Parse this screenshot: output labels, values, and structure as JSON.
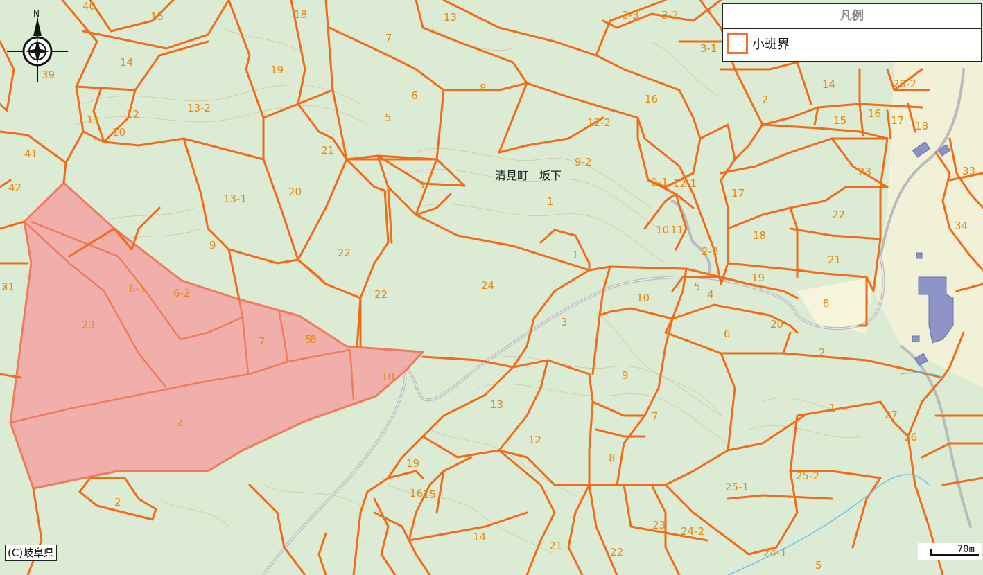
{
  "map": {
    "place_name": "清見町　坂下",
    "compass_north": "N",
    "copyright": "(C)岐阜県",
    "scale_label": "70m",
    "colors": {
      "background": "#dcebd3",
      "boundary": "#f06c18",
      "label": "#e8870e",
      "highlight_fill": "#f4a4a4",
      "highlight_stroke": "#f07a5a",
      "road": "#b9bbbd",
      "building": "#8d93c7"
    }
  },
  "legend": {
    "title": "凡例",
    "items": [
      {
        "label": "小班界",
        "swatch": "orange-outline"
      }
    ]
  },
  "parcels": {
    "highlighted": [
      "5",
      "6-1",
      "6-2",
      "7",
      "8",
      "3",
      "4"
    ],
    "labels": [
      "15",
      "18",
      "13",
      "3-3",
      "3-2",
      "3-1",
      "40",
      "14",
      "39",
      "7",
      "19",
      "13-2",
      "12",
      "11",
      "10",
      "41",
      "6",
      "8",
      "5",
      "16",
      "12-2",
      "14",
      "20-2",
      "16",
      "15",
      "17",
      "18",
      "21",
      "3",
      "4",
      "42",
      "20",
      "13-1",
      "9-2",
      "9-1",
      "12-1",
      "17",
      "23",
      "33",
      "2",
      "1",
      "22",
      "22",
      "9",
      "10",
      "18",
      "34",
      "21",
      "22",
      "24",
      "6-1",
      "6-2",
      "1",
      "10",
      "2-3",
      "5",
      "4",
      "19",
      "21",
      "8",
      "5",
      "23",
      "10",
      "11",
      "3",
      "20",
      "7",
      "8",
      "6",
      "2",
      "3",
      "9",
      "13",
      "1",
      "27",
      "26",
      "4",
      "12",
      "7",
      "8",
      "25-1",
      "25-2",
      "2",
      "19",
      "16",
      "15",
      "14",
      "23",
      "24-2",
      "21",
      "22",
      "24-1",
      "5"
    ]
  }
}
